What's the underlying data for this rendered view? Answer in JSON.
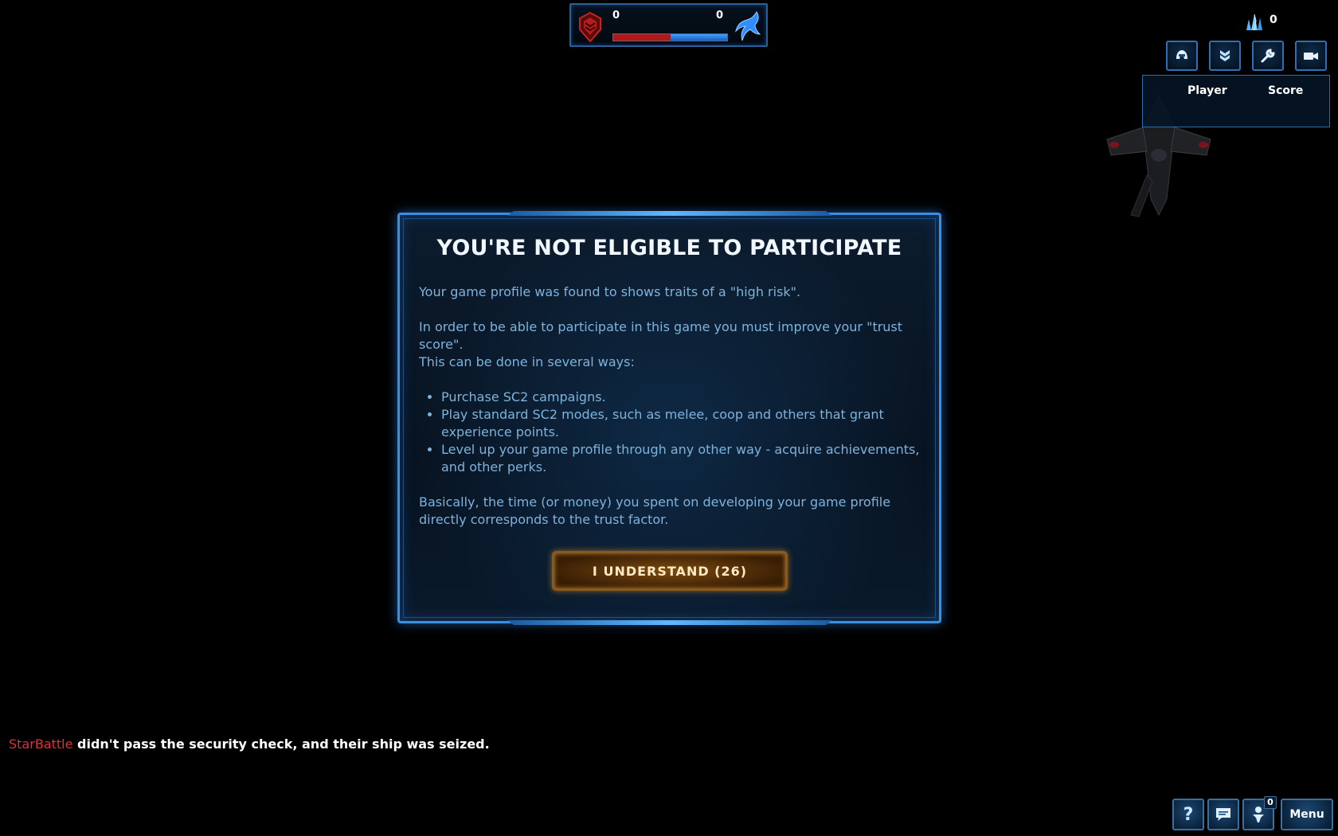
{
  "scoreboard": {
    "left_score": "0",
    "right_score": "0",
    "red_share": 0.5,
    "left_team_icon": "terran-red-emblem-icon",
    "right_team_icon": "protoss-blue-emblem-icon"
  },
  "resources": {
    "crystal_icon": "mineral-crystal-icon",
    "crystal_count": "0"
  },
  "toolbar": {
    "buttons": [
      {
        "icon": "helmet-icon"
      },
      {
        "icon": "rank-chevron-icon"
      },
      {
        "icon": "wrench-icon"
      },
      {
        "icon": "camera-icon"
      }
    ]
  },
  "player_panel": {
    "col_player": "Player",
    "col_score": "Score"
  },
  "dialog": {
    "title": "YOU'RE NOT ELIGIBLE TO PARTICIPATE",
    "para1": "Your game profile was found to shows traits of a \"high risk\".",
    "para2": "In order to be able to participate in this game you must improve your \"trust score\".",
    "para3": "This can be done in several ways:",
    "bullets": [
      "Purchase SC2 campaigns.",
      "Play standard SC2 modes, such as melee, coop and others that grant experience points.",
      "Level up your game profile through any other way - acquire achievements, and other perks."
    ],
    "para4": "Basically, the time (or money) you spent on developing your game profile directly corresponds to the trust factor.",
    "button_label": "I UNDERSTAND (26)"
  },
  "message": {
    "player_name": "StarBattle",
    "text": " didn't pass the security check, and their ship was seized."
  },
  "bottom_bar": {
    "help_icon": "question-mark-icon",
    "chat_icon": "chat-bubble-icon",
    "social_icon": "social-person-icon",
    "social_count": "0",
    "menu_label": "Menu"
  },
  "colors": {
    "accent_blue": "#3a8fe0",
    "button_gold": "#8a5a1c",
    "player_name_red": "#e0303a"
  }
}
